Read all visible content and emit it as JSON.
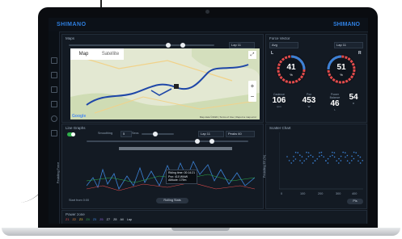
{
  "app": {
    "brand": "SHIMANO",
    "brand_right": "SHIMANO"
  },
  "map_panel": {
    "title": "Maps",
    "lap_select": "Lap 11",
    "tabs": [
      "Map",
      "Satellite"
    ],
    "zoom_in": "+",
    "zoom_out": "−",
    "fullscreen": "⤢",
    "google": "Google",
    "copyright": "Map data ©2020 | Terms of Use | Report a map error"
  },
  "gauge_panel": {
    "title": "Force Vector",
    "avg_select": "Avg",
    "lap_select": "Lap 11",
    "left_label": "L",
    "right_label": "R",
    "left_value": "41",
    "left_unit": "%",
    "right_value": "51",
    "right_unit": "%",
    "stats": [
      {
        "label": "Cadence",
        "value": "106",
        "unit": "rpm"
      },
      {
        "label": "Pwr",
        "value": "453",
        "unit": "W"
      },
      {
        "label": "Power Balance",
        "value": "46",
        "unit": "L"
      },
      {
        "label": "",
        "value": "54",
        "unit": "R"
      }
    ]
  },
  "line_panel": {
    "title": "Line Graphs",
    "smoothing_label": "Smoothing",
    "smoothing_value": "5",
    "secs_label": "Secs",
    "lap_select": "Lap 11",
    "peaks_select": "Peaks 60",
    "y_label": "Pedalling Force",
    "tooltip": [
      "Riding time: 00:14:21",
      "Pwr: 410 W/kW",
      "Altitude: 179m"
    ],
    "start_label": "Start from 0:00",
    "rolling_button": "Rolling Stats"
  },
  "scatter_panel": {
    "title": "Scatter Chart",
    "y_label": "Pedalling Eff (%)",
    "x_ticks": [
      "0",
      "100",
      "200",
      "300",
      "400"
    ],
    "y_ticks": [
      "100",
      "75",
      "50",
      "25"
    ],
    "button": "Pls"
  },
  "power_zone": {
    "title": "Power zone",
    "items": [
      "Z1",
      "Z2",
      "Z3",
      "Z4",
      "Z5",
      "Z6",
      "Z7",
      "Z8",
      "All",
      "Lap"
    ]
  }
}
